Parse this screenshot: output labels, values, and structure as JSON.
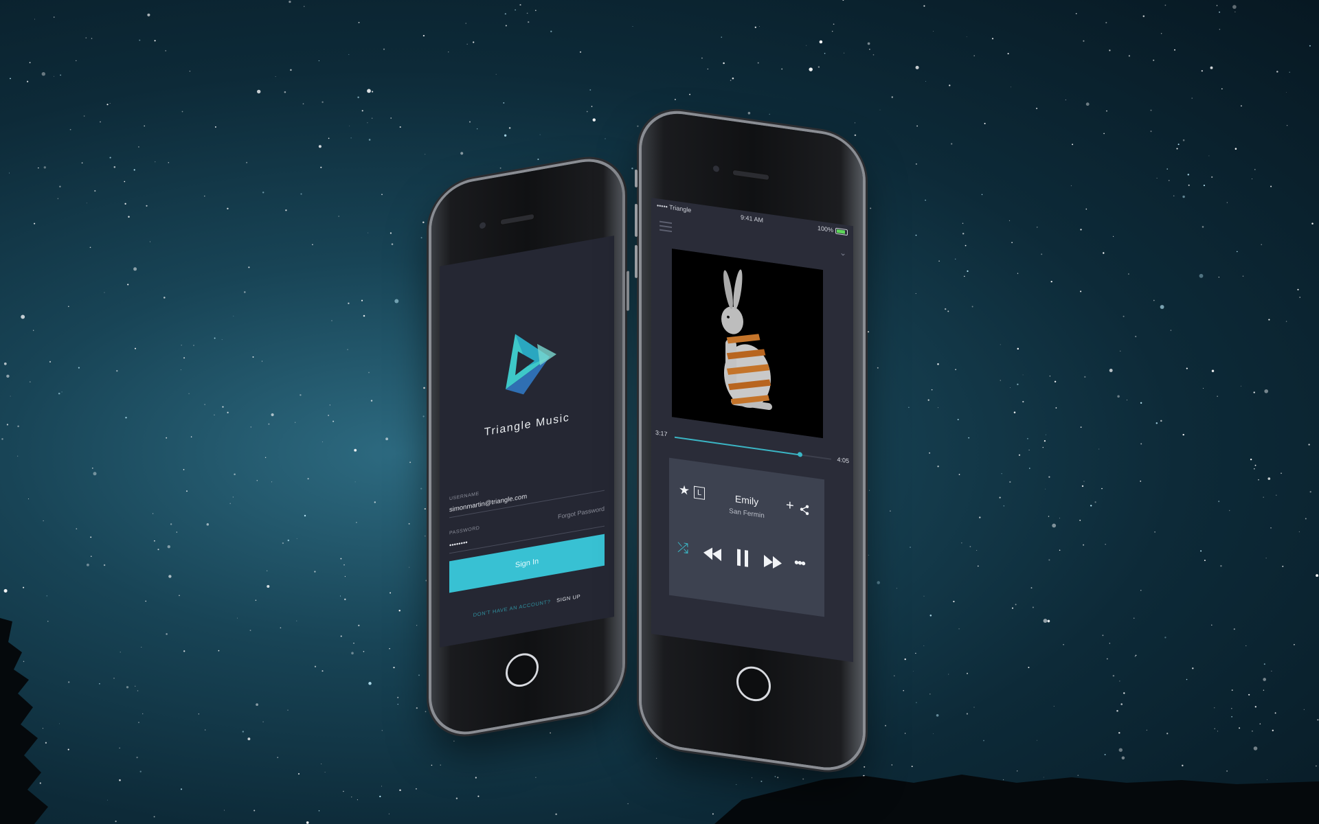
{
  "login_screen": {
    "app_name": "Triangle Music",
    "username_label": "USERNAME",
    "username_value": "simonmartin@triangle.com",
    "password_label": "PASSWORD",
    "password_value": "••••••••",
    "forgot_password": "Forgot Password",
    "sign_in": "Sign In",
    "no_account": "DON'T HAVE AN ACCOUNT?",
    "sign_up": "SIGN UP",
    "accent_color": "#38c1d3"
  },
  "player_screen": {
    "status": {
      "carrier": "••••• Triangle",
      "time": "9:41 AM",
      "battery": "100%"
    },
    "track": {
      "elapsed": "3:17",
      "total": "4:05",
      "progress": 0.8,
      "title": "Emily",
      "artist": "San Fermin"
    },
    "icons": {
      "menu": "menu-icon",
      "collapse": "chevron-down-icon",
      "favorite": "star-icon",
      "lyrics": "lyrics-icon",
      "add": "plus-icon",
      "share": "share-icon",
      "shuffle": "shuffle-icon",
      "previous": "rewind-icon",
      "pause": "pause-icon",
      "next": "fast-forward-icon",
      "more": "more-icon"
    },
    "accent_color": "#3ab6c5"
  }
}
